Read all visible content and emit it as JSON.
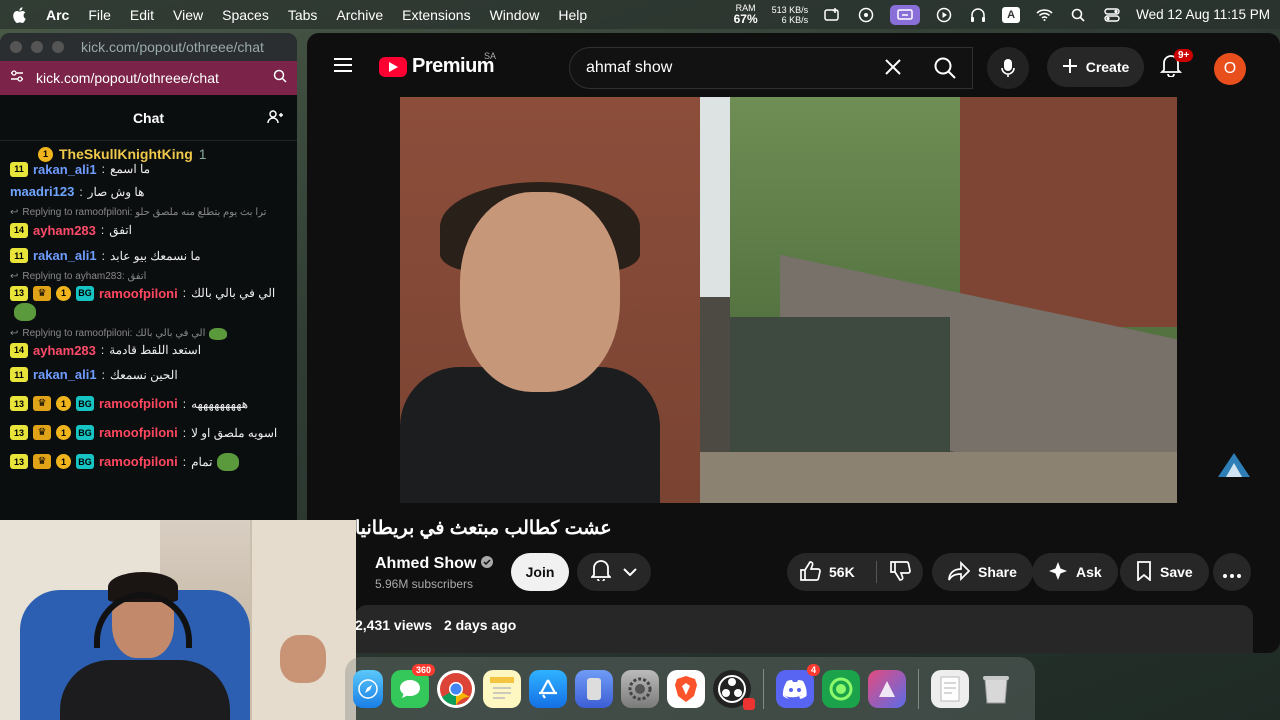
{
  "menubar": {
    "app": "Arc",
    "items": [
      "File",
      "Edit",
      "View",
      "Spaces",
      "Tabs",
      "Archive",
      "Extensions",
      "Window",
      "Help"
    ],
    "ram_label": "RAM",
    "ram_value": "67%",
    "net_up": "513 KB/s",
    "net_down": "6 KB/s",
    "input_source": "A",
    "clock": "Wed 12 Aug  11:15 PM"
  },
  "chat": {
    "window_title": "kick.com/popout/othreee/chat",
    "url": "kick.com/popout/othreee/chat",
    "header": "Chat",
    "pinned_user": "TheSkullKnightKing",
    "pinned_count": "1",
    "messages": [
      {
        "badge": "11",
        "user": "rakan_ali1",
        "text": "ما اسمع",
        "type": "partial"
      },
      {
        "user": "maadri123",
        "text": "ها وش صار"
      },
      {
        "reply": "Replying to ramoofpiloni: ترا بث يوم بتطلع منه ملصق حلو"
      },
      {
        "badge": "14",
        "user": "ayham283",
        "text": "اتفق"
      },
      {
        "badge": "11",
        "user": "rakan_ali1",
        "text": "ما نسمعك بيو عابد"
      },
      {
        "reply": "Replying to ayham283: اتفق"
      },
      {
        "badge": "13",
        "coin": "1",
        "bg": "BG",
        "user": "ramoofpiloni",
        "text": "الي في بالي بالك"
      },
      {
        "reply": "Replying to ramoofpiloni: الي في بالي بالك"
      },
      {
        "badge": "14",
        "user": "ayham283",
        "text": "استعد اللقط قادمة"
      },
      {
        "badge": "11",
        "user": "rakan_ali1",
        "text": "الحين نسمعك"
      },
      {
        "badge": "13",
        "coin": "1",
        "bg": "BG",
        "user": "ramoofpiloni",
        "text": "هههههههههه"
      },
      {
        "badge": "13",
        "coin": "1",
        "bg": "BG",
        "user": "ramoofpiloni",
        "text": "اسويه ملصق او لا"
      },
      {
        "badge": "13",
        "coin": "1",
        "bg": "BG",
        "user": "ramoofpiloni",
        "text": "تمام"
      }
    ]
  },
  "youtube": {
    "logo_text": "Premium",
    "region": "SA",
    "search_value": "ahmaf show",
    "create_label": "Create",
    "notif_count": "9+",
    "avatar_letter": "O",
    "video_title": "عشت كطالب مبتعث في بريطانيا",
    "channel_name": "Ahmed Show",
    "subscribers": "5.96M subscribers",
    "join_label": "Join",
    "likes": "56K",
    "share_label": "Share",
    "ask_label": "Ask",
    "save_label": "Save",
    "views": "2,431 views",
    "date": "2 days ago"
  },
  "dock": {
    "messages_badge": "360",
    "discord_badge": "4"
  }
}
